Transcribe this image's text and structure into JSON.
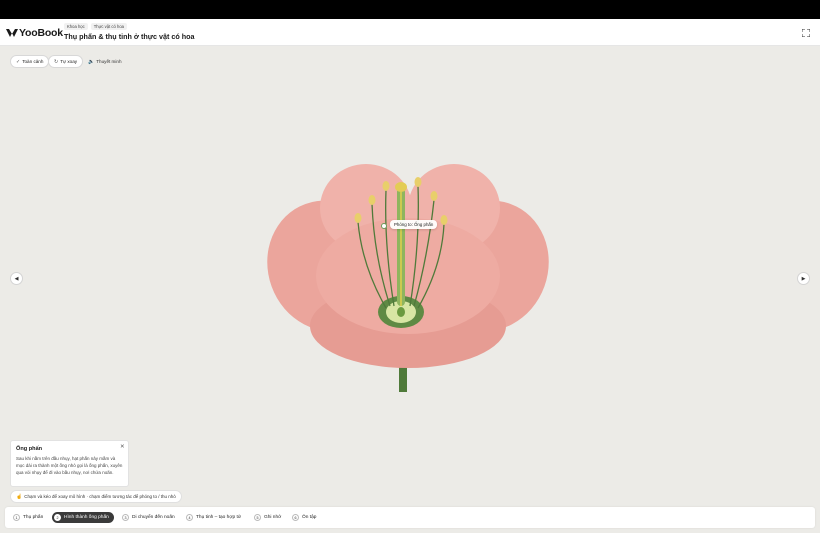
{
  "header": {
    "logo_text": "YooBook",
    "breadcrumbs": [
      "Khoa học",
      "Thực vật có hoa"
    ],
    "title": "Thụ phấn & thụ tinh ở thực vật có hoa"
  },
  "toolbar": {
    "overview_label": "Toàn cảnh",
    "autorotate_label": "Tự xoay",
    "narration_label": "Thuyết minh"
  },
  "stage": {
    "callout": "Phóng to: Ống phấn",
    "info": {
      "title": "Ống phấn",
      "body": "Sau khi nằm trên đầu nhụy, hạt phấn nảy mầm và mọc dài ra thành một ống nhỏ gọi là ống phấn, xuyên qua vòi nhụy để đi vào bầu nhụy, nơi chứa noãn."
    },
    "hint": "Chạm và kéo để xoay mô hình · chạm điểm tương tác để phóng to / thu nhỏ",
    "prev_label": "◀",
    "next_label": "▶"
  },
  "steps": [
    {
      "num": "1",
      "label": "Thụ phấn"
    },
    {
      "num": "2",
      "label": "Hình thành ống phấn"
    },
    {
      "num": "3",
      "label": "Di chuyển đến noãn"
    },
    {
      "num": "4",
      "label": "Thụ tinh – tạo hợp tử"
    },
    {
      "num": "5",
      "label": "Ghi nhớ"
    },
    {
      "num": "6",
      "label": "Ôn tập"
    }
  ],
  "colors": {
    "petal": "#eea9a0",
    "stem": "#4f7a3a",
    "anther": "#e8cf6a",
    "active_step": "#3a3a3a"
  }
}
